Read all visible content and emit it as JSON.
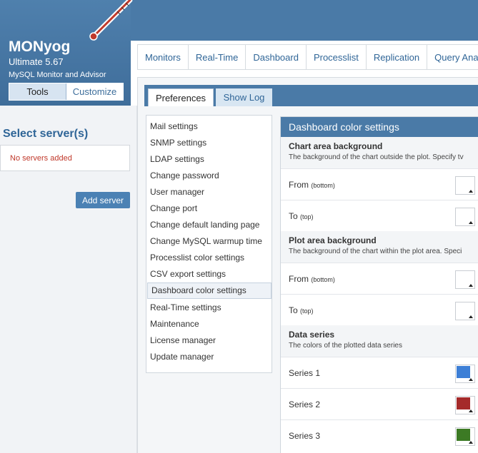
{
  "brand": {
    "title": "MONyog",
    "version": "Ultimate 5.67",
    "tagline": "MySQL Monitor and Advisor",
    "tabs": [
      {
        "label": "Tools",
        "active": true
      },
      {
        "label": "Customize",
        "active": false
      }
    ]
  },
  "servers": {
    "title": "Select server(s)",
    "empty_text": "No servers added",
    "add_label": "Add server"
  },
  "main_nav": [
    "Monitors",
    "Real-Time",
    "Dashboard",
    "Processlist",
    "Replication",
    "Query Analyz"
  ],
  "sub_tabs": {
    "active": "Preferences",
    "inactive": "Show Log"
  },
  "settings": [
    "Mail settings",
    "SNMP settings",
    "LDAP settings",
    "Change password",
    "User manager",
    "Change port",
    "Change default landing page",
    "Change MySQL warmup time",
    "Processlist color settings",
    "CSV export settings",
    "Dashboard color settings",
    "Real-Time settings",
    "Maintenance",
    "License manager",
    "Update manager"
  ],
  "active_setting": "Dashboard color settings",
  "detail": {
    "header": "Dashboard color settings",
    "chart_area": {
      "title": "Chart area background",
      "desc": "The background of the chart outside the plot. Specify tv",
      "from_label": "From",
      "from_sub": "(bottom)",
      "to_label": "To",
      "to_sub": "(top)"
    },
    "plot_area": {
      "title": "Plot area background",
      "desc": "The background of the chart within the plot area. Speci",
      "from_label": "From",
      "from_sub": "(bottom)",
      "to_label": "To",
      "to_sub": "(top)"
    },
    "data_series": {
      "title": "Data series",
      "desc": "The colors of the plotted data series",
      "series": [
        {
          "label": "Series 1",
          "color": "#3d7fd6"
        },
        {
          "label": "Series 2",
          "color": "#a52a2a"
        },
        {
          "label": "Series 3",
          "color": "#3c7a24"
        }
      ]
    }
  },
  "colors": {
    "header_blue": "#4a7aa7",
    "link_blue": "#2f6597",
    "error_red": "#c0392b"
  }
}
